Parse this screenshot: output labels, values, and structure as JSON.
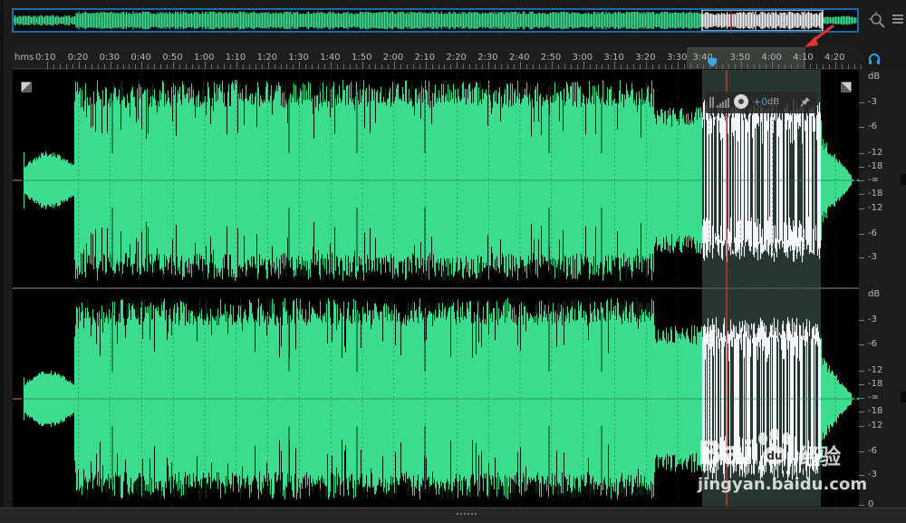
{
  "ruler": {
    "format": "hms",
    "labels": [
      "0:10",
      "0:20",
      "0:30",
      "0:40",
      "0:50",
      "1:00",
      "1:10",
      "1:20",
      "1:30",
      "1:40",
      "1:50",
      "2:00",
      "2:10",
      "2:20",
      "2:30",
      "2:40",
      "2:50",
      "3:00",
      "3:10",
      "3:20",
      "3:30",
      "3:40",
      "3:50",
      "4:00",
      "4:10",
      "4:20"
    ],
    "selection_label": "3:40"
  },
  "db_scale": {
    "channel1": [
      "dB",
      "-3",
      "-6",
      "-12",
      "-18",
      "-∞",
      "-18",
      "-12",
      "-6",
      "-3"
    ],
    "channel2": [
      "dB",
      "-3",
      "-6",
      "-12",
      "-18",
      "-∞",
      "-18",
      "-12",
      "-6",
      "-3",
      "0"
    ]
  },
  "hud": {
    "gain_value": "+0",
    "gain_unit": "dB"
  },
  "watermark": {
    "brand": "Bai",
    "brand_suffix": "经验",
    "url": "jingyan.baidu.com"
  },
  "colors": {
    "waveform": "#3ddc8f",
    "waveform_selected": "#f4f6fb",
    "selection_bg": "#26372f",
    "playhead": "#e23b3b",
    "overview_border": "#1c6aa8",
    "accent": "#3aa8e8",
    "annotation_arrow": "#e8312a"
  }
}
